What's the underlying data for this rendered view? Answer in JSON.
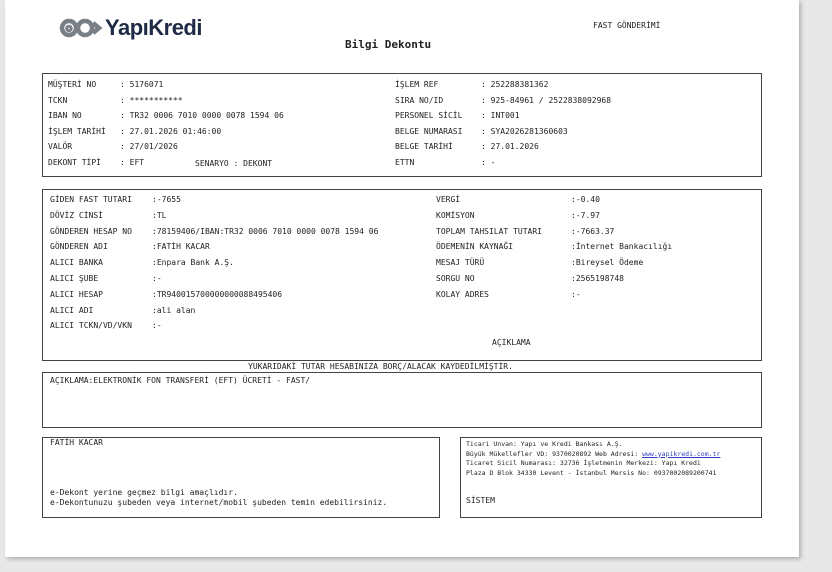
{
  "header": {
    "bank_name": "YapıKredi",
    "transfer_type": "FAST GÖNDERİMİ",
    "doc_title": "Bilgi Dekontu"
  },
  "info_left": [
    {
      "label": "MÜŞTERİ NO",
      "value": "5176071"
    },
    {
      "label": "TCKN",
      "value": "***********"
    },
    {
      "label": "IBAN NO",
      "value": "TR32 0006 7010 0000 0078 1594 06"
    },
    {
      "label": "İŞLEM TARİHİ",
      "value": "27.01.2026 01:46:00"
    },
    {
      "label": "VALÖR",
      "value": "27/01/2026"
    },
    {
      "label": "DEKONT TİPİ",
      "value": "EFT"
    }
  ],
  "info_scenario": {
    "label": "SENARYO",
    "value": "DEKONT"
  },
  "info_right": [
    {
      "label": "İŞLEM REF",
      "value": "252288381362"
    },
    {
      "label": "SIRA NO/ID",
      "value": "925-84961 / 2522838092968"
    },
    {
      "label": "PERSONEL SİCİL",
      "value": "INT001"
    },
    {
      "label": "BELGE NUMARASI",
      "value": "SYA2026281360603"
    },
    {
      "label": "BELGE TARİHİ",
      "value": "27.01.2026"
    },
    {
      "label": "ETTN",
      "value": "-"
    }
  ],
  "detail_left": [
    {
      "label": "GİDEN FAST TUTARI",
      "value": "-7655"
    },
    {
      "label": "DÖVİZ CİNSİ",
      "value": "TL"
    },
    {
      "label": "GÖNDEREN HESAP NO",
      "value": "78159406/IBAN:TR32 0006 7010 0000 0078 1594 06"
    },
    {
      "label": "GÖNDEREN ADI",
      "value": "FATİH KACAR"
    },
    {
      "label": "ALICI BANKA",
      "value": "Enpara Bank A.Ş."
    },
    {
      "label": "ALICI ŞUBE",
      "value": "-"
    },
    {
      "label": "ALICI HESAP",
      "value": "TR940015700000000088495406"
    },
    {
      "label": "ALICI ADI",
      "value": "ali alan"
    },
    {
      "label": "ALICI TCKN/VD/VKN",
      "value": "-"
    }
  ],
  "detail_right": [
    {
      "label": "VERGİ",
      "value": "-0.40"
    },
    {
      "label": "KOMİSYON",
      "value": "-7.97"
    },
    {
      "label": "TOPLAM TAHSILAT TUTARI",
      "value": "-7663.37"
    },
    {
      "label": "ÖDEMENİN KAYNAĞI",
      "value": "İnternet Bankacılığı"
    },
    {
      "label": "MESAJ TÜRÜ",
      "value": "Bireysel Ödeme"
    },
    {
      "label": "SORGU NO",
      "value": "2565198748"
    },
    {
      "label": "KOLAY ADRES",
      "value": "-"
    }
  ],
  "aciklama_heading": "AÇIKLAMA",
  "debit_notice": "YUKARIDAKİ TUTAR HESABINIZA BORÇ/ALACAK KAYDEDİLMİŞTİR.",
  "description": "AÇIKLAMA:ELEKTRONİK FON TRANSFERİ (EFT) ÜCRETİ - FAST/",
  "footer_left": {
    "name": "FATİH KACAR",
    "note1": "e-Dekont yerine geçmez bilgi amaçlıdır.",
    "note2": "e-Dekontunuzu şubeden veya internet/mobil şubeden temin edebilirsiniz."
  },
  "footer_right": {
    "line1": "Ticari Unvan: Yapı ve Kredi Bankası A.Ş.",
    "line2_prefix": "Büyük Mükellefler VD: 9370020892 Web Adresi: ",
    "website": "www.yapikredi.com.tr",
    "line3": "Ticaret Sicil Numarası: 32736 İşletmenin Merkezi: Yapı Kredi",
    "line4": "Plaza D Blok 34330 Levent - İstanbul Mersis No: 0937002089200741",
    "system": "SİSTEM"
  },
  "colors": {
    "logo": "#1f2a44",
    "link": "#2a3fbf",
    "border": "#444444"
  }
}
